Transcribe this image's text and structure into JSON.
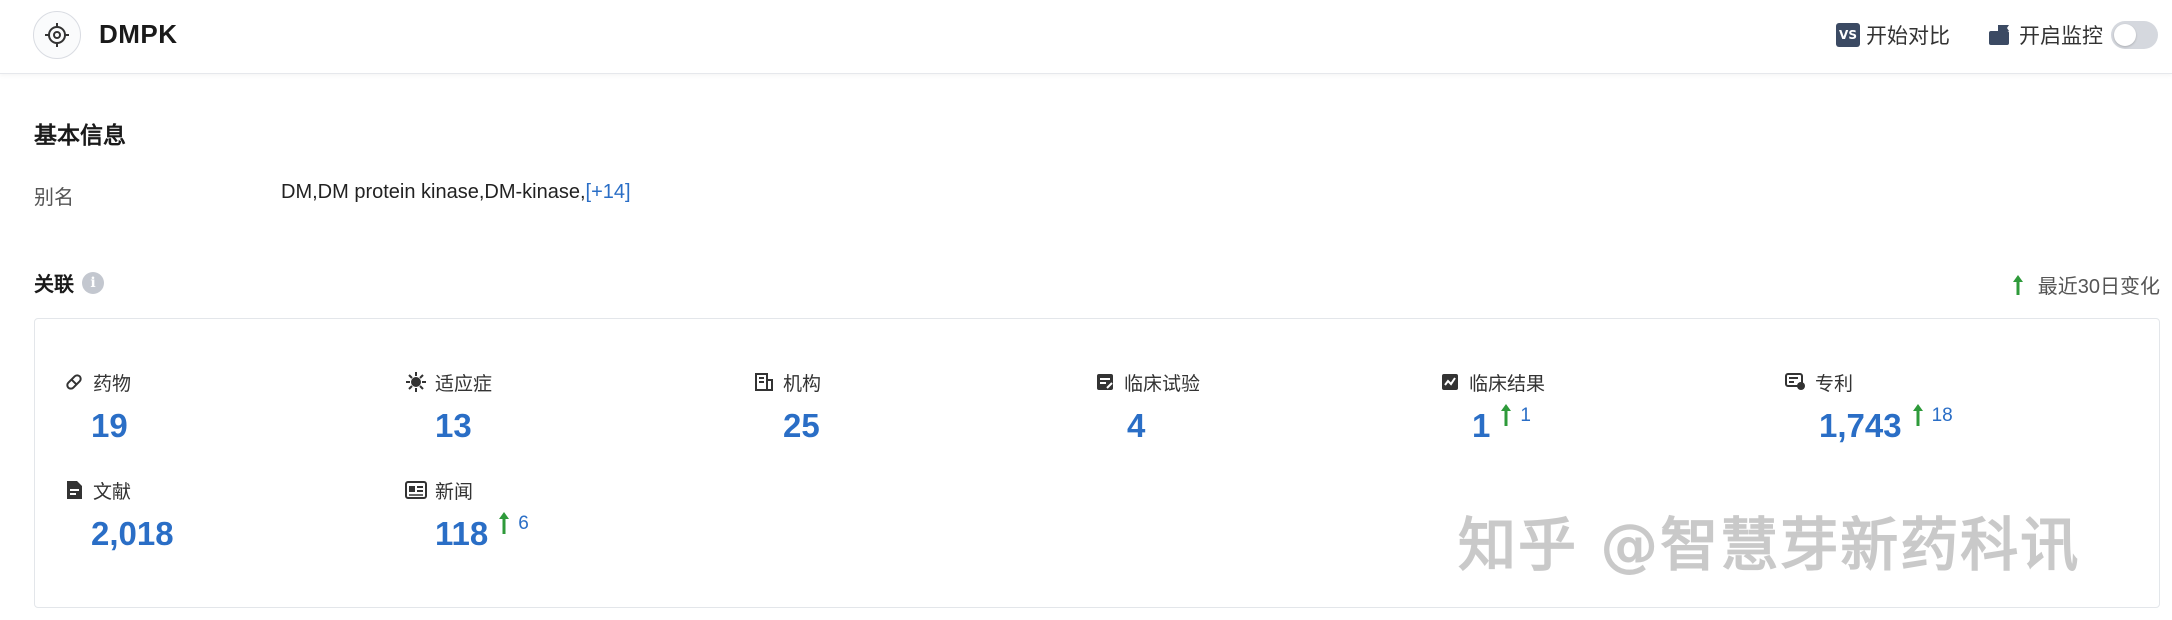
{
  "header": {
    "title": "DMPK",
    "compare_badge": "VS",
    "compare_label": "开始对比",
    "monitor_label": "开启监控"
  },
  "basic_info": {
    "title": "基本信息",
    "alias_label": "别名",
    "alias_value": "DM,DM protein kinase,DM-kinase,",
    "alias_more": "[+14]"
  },
  "association": {
    "title": "关联",
    "info_icon_glyph": "i",
    "recent_change_label": "最近30日变化",
    "stats": [
      {
        "label": "药物",
        "value": "19",
        "icon": "pill-icon"
      },
      {
        "label": "适应症",
        "value": "13",
        "icon": "virus-icon"
      },
      {
        "label": "机构",
        "value": "25",
        "icon": "building-icon"
      },
      {
        "label": "临床试验",
        "value": "4",
        "icon": "clinical-trial-icon"
      },
      {
        "label": "临床结果",
        "value": "1",
        "delta": "1",
        "icon": "clinical-result-icon"
      },
      {
        "label": "专利",
        "value": "1,743",
        "delta": "18",
        "icon": "patent-icon"
      },
      {
        "label": "文献",
        "value": "2,018",
        "icon": "document-icon"
      },
      {
        "label": "新闻",
        "value": "118",
        "delta": "6",
        "icon": "news-icon"
      }
    ]
  },
  "watermark": "知乎 @智慧芽新药科讯",
  "colors": {
    "accent_blue": "#2a6ec6",
    "up_green": "#2e9a3a",
    "vs_badge": "#3b4a63",
    "toggle_off": "#d5d8de"
  }
}
